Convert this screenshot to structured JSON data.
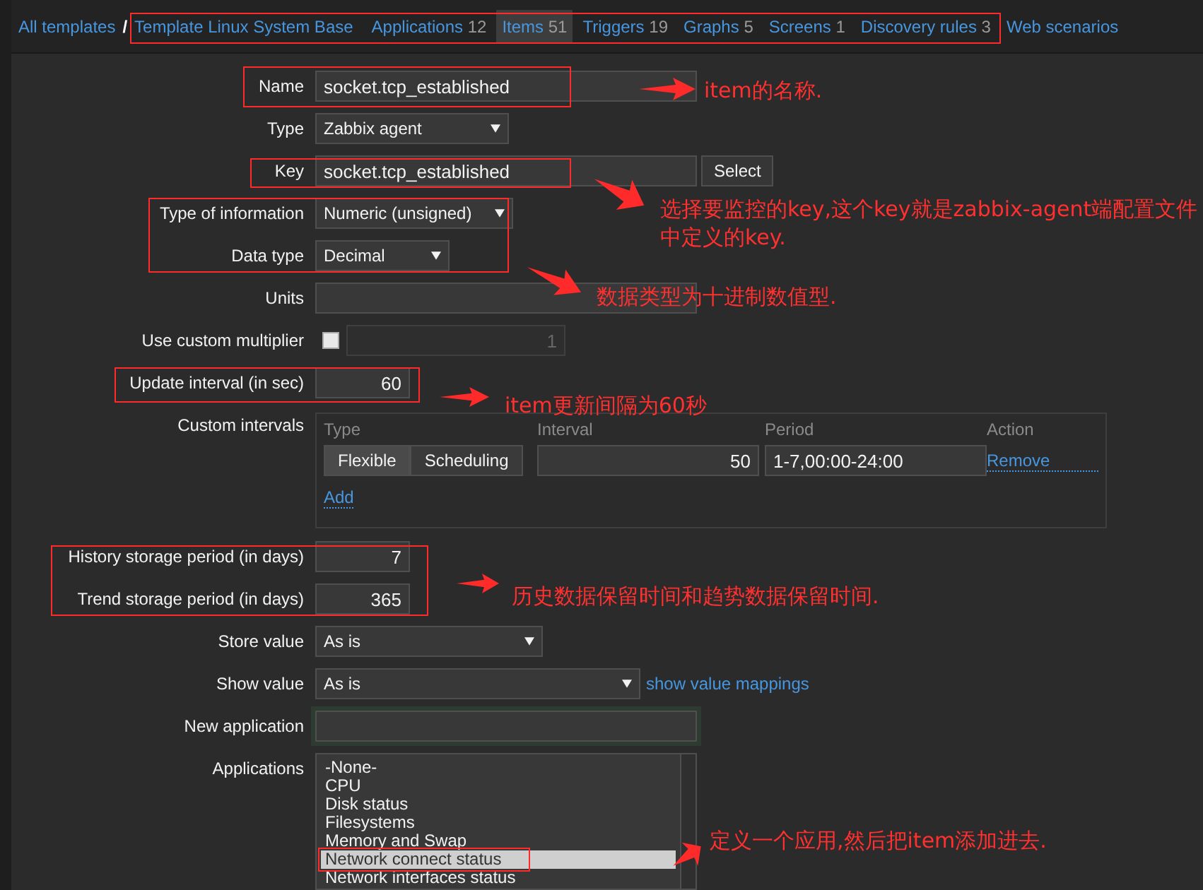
{
  "breadcrumb": {
    "root": "All templates",
    "separator": "/",
    "template": "Template Linux System Base"
  },
  "tabs": [
    {
      "label": "Applications",
      "count": "12",
      "selected": false
    },
    {
      "label": "Items",
      "count": "51",
      "selected": true
    },
    {
      "label": "Triggers",
      "count": "19",
      "selected": false
    },
    {
      "label": "Graphs",
      "count": "5",
      "selected": false
    },
    {
      "label": "Screens",
      "count": "1",
      "selected": false
    },
    {
      "label": "Discovery rules",
      "count": "3",
      "selected": false
    },
    {
      "label": "Web scenarios",
      "selected": false
    }
  ],
  "form": {
    "rows": [
      {
        "kind": "input",
        "label": "Name",
        "value": "socket.tcp_established"
      },
      {
        "kind": "select",
        "label": "Type",
        "value": "Zabbix agent"
      },
      {
        "kind": "input_button",
        "label": "Key",
        "value": "socket.tcp_established",
        "button": "Select"
      },
      {
        "kind": "select",
        "label": "Type of information",
        "value": "Numeric (unsigned)"
      },
      {
        "kind": "select",
        "label": "Data type",
        "value": "Decimal"
      },
      {
        "kind": "input",
        "label": "Units"
      },
      {
        "kind": "checkbox_input",
        "label": "Use custom multiplier",
        "checked": false,
        "value": "1"
      },
      {
        "kind": "number",
        "label": "Update interval (in sec)",
        "value": "60"
      },
      {
        "kind": "intervals",
        "label": "Custom intervals",
        "columns": [
          "Type",
          "Interval",
          "Period",
          "Action"
        ],
        "rows": [
          {
            "modes": [
              {
                "label": "Flexible",
                "selected": true
              },
              {
                "label": "Scheduling",
                "selected": false
              }
            ],
            "interval": "50",
            "period": "1-7,00:00-24:00",
            "action": "Remove"
          }
        ],
        "add": "Add"
      },
      {
        "kind": "number",
        "label": "History storage period (in days)",
        "value": "7"
      },
      {
        "kind": "number",
        "label": "Trend storage period (in days)",
        "value": "365"
      },
      {
        "kind": "select",
        "label": "Store value",
        "value": "As is"
      },
      {
        "kind": "select_link",
        "label": "Show value",
        "value": "As is",
        "link": "show value mappings"
      },
      {
        "kind": "input",
        "label": "New application",
        "focused": true
      },
      {
        "kind": "listbox",
        "label": "Applications",
        "options": [
          {
            "label": "-None-",
            "selected": false
          },
          {
            "label": "CPU",
            "selected": false
          },
          {
            "label": "Disk status",
            "selected": false
          },
          {
            "label": "Filesystems",
            "selected": false
          },
          {
            "label": "Memory and Swap",
            "selected": false
          },
          {
            "label": "Network connect status",
            "selected": true
          },
          {
            "label": "Network interfaces status",
            "selected": false
          }
        ]
      }
    ]
  },
  "annotations": [
    {
      "text": "item的名称."
    },
    {
      "text": "选择要监控的key,这个key就是zabbix-agent端配置文件中定义的key."
    },
    {
      "text": "数据类型为十进制数值型."
    },
    {
      "text": "item更新间隔为60秒"
    },
    {
      "text": "历史数据保留时间和趋势数据保留时间."
    },
    {
      "text": "定义一个应用,然后把item添加进去."
    }
  ]
}
